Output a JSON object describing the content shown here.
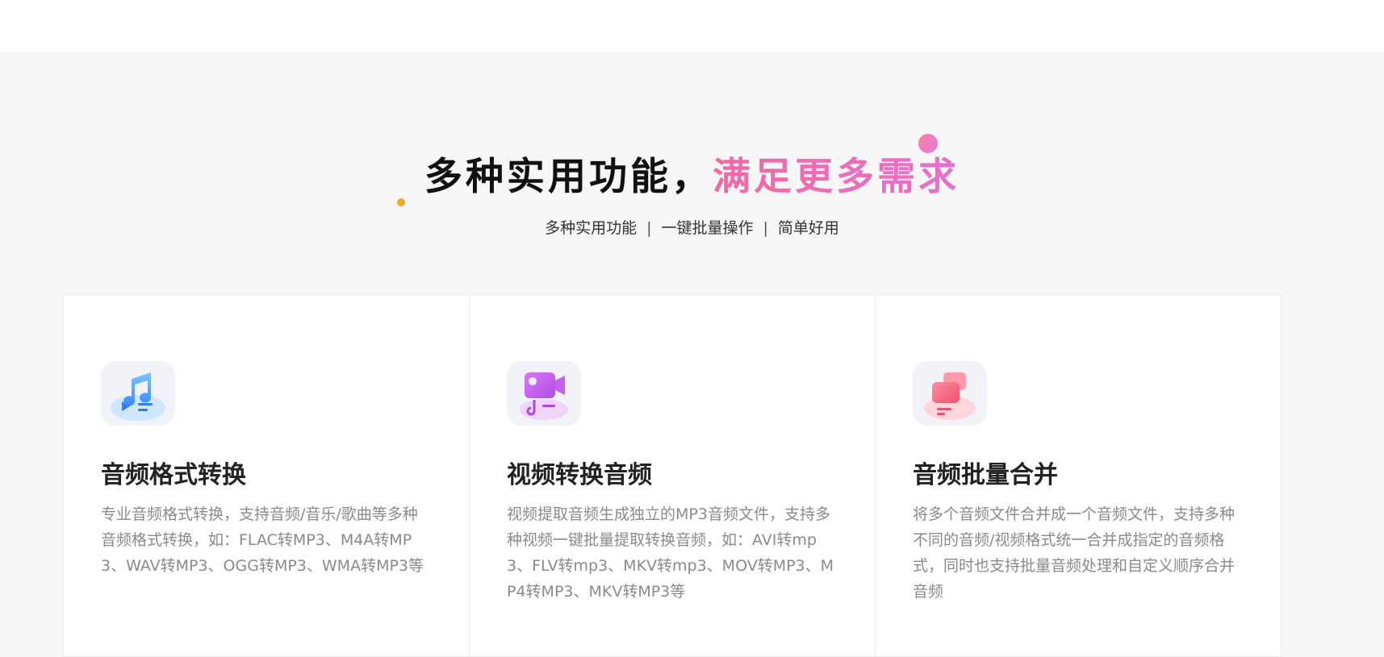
{
  "section": {
    "headline_dark": "多种实用功能，",
    "headline_pink": "满足更多需求",
    "sub_items": [
      "多种实用功能",
      "一键批量操作",
      "简单好用"
    ],
    "sub_separator": "|"
  },
  "colors": {
    "accent_pink": "#ee5d9e",
    "dot_orange": "#f5a623",
    "background": "#f6f6f6"
  },
  "features": [
    {
      "icon": "audio-format-convert-icon",
      "title": "音频格式转换",
      "desc": "专业音频格式转换，支持音频/音乐/歌曲等多种音频格式转换，如：FLAC转MP3、M4A转MP3、WAV转MP3、OGG转MP3、WMA转MP3等"
    },
    {
      "icon": "video-to-audio-icon",
      "title": "视频转换音频",
      "desc": "视频提取音频生成独立的MP3音频文件，支持多种视频一键批量提取转换音频，如：AVI转mp3、FLV转mp3、MKV转mp3、MOV转MP3、MP4转MP3、MKV转MP3等"
    },
    {
      "icon": "audio-merge-icon",
      "title": "音频批量合并",
      "desc": "将多个音频文件合并成一个音频文件，支持多种不同的音频/视频格式统一合并成指定的音频格式，同时也支持批量音频处理和自定义顺序合并音频"
    }
  ]
}
